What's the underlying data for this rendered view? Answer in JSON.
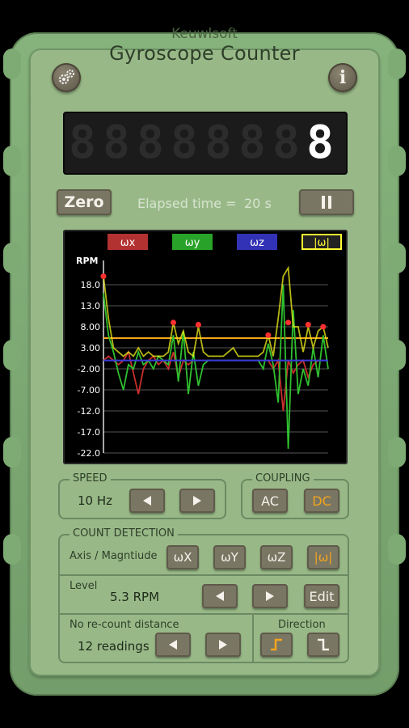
{
  "header": {
    "brand": "Keuwlsoft",
    "title": "Gyroscope Counter",
    "settings_icon": "gear-icon",
    "info_label": "i"
  },
  "counter": {
    "digits": [
      "8",
      "8",
      "8",
      "8",
      "8",
      "8",
      "8",
      "8"
    ],
    "active_index": 7
  },
  "controls": {
    "zero_label": "Zero",
    "elapsed_label": "Elapsed time =",
    "elapsed_value": "20 s",
    "pause_icon": "pause-icon"
  },
  "chart_data": {
    "type": "line",
    "legend": [
      "ωx",
      "ωy",
      "ωz",
      "|ω|"
    ],
    "legend_colors": [
      "#d23a3a",
      "#2fbf2f",
      "#3b3bd6",
      "#ffff33"
    ],
    "ylabel": "RPM",
    "yticks": [
      "18.0",
      "13.0",
      "8.00",
      "3.00",
      "-2.00",
      "-7.00",
      "-12.0",
      "-17.0",
      "-22.0"
    ],
    "ylim": [
      -22,
      23
    ],
    "level_line": 5.3,
    "series": [
      {
        "name": "ωx",
        "color": "#c8302c",
        "values": [
          0,
          1,
          0,
          -1,
          0,
          2,
          -3,
          -8,
          -2,
          0,
          1,
          -1,
          0,
          -2,
          2,
          -4,
          0,
          -1,
          0,
          0,
          0,
          0,
          0,
          0,
          0,
          0,
          0,
          0,
          0,
          0,
          0,
          0,
          0,
          0,
          -2,
          0,
          -12,
          0,
          -3,
          -1,
          0,
          -4,
          -1,
          0,
          0,
          0
        ]
      },
      {
        "name": "ωy",
        "color": "#2fbf2f",
        "values": [
          16,
          6,
          2,
          -3,
          -7,
          -1,
          -2,
          2,
          -1,
          0,
          -2,
          1,
          0,
          -1,
          6,
          -5,
          7,
          -8,
          2,
          -6,
          -1,
          0,
          0,
          0,
          0,
          0,
          0,
          0,
          0,
          0,
          0,
          0,
          -2,
          4,
          -1,
          -10,
          18,
          -21,
          12,
          -8,
          -2,
          -6,
          3,
          -4,
          6,
          -2
        ]
      },
      {
        "name": "ωz",
        "color": "#3a3ad8",
        "values": [
          0,
          0,
          0,
          0,
          0,
          0,
          0,
          0,
          0,
          0,
          0,
          0,
          0,
          0,
          0,
          0,
          0,
          0,
          0,
          0,
          0,
          0,
          0,
          0,
          0,
          0,
          0,
          0,
          0,
          0,
          0,
          0,
          0,
          0,
          0,
          0,
          0,
          0,
          0,
          0,
          0,
          0,
          0,
          0,
          0,
          0
        ]
      },
      {
        "name": "|ω|",
        "color": "#f2f21c",
        "values": [
          20,
          10,
          3,
          2,
          1,
          2,
          1,
          3,
          1,
          2,
          1,
          1,
          1,
          2,
          9,
          4,
          7,
          2,
          1,
          8,
          2,
          1,
          1,
          1,
          1,
          2,
          3,
          1,
          1,
          1,
          1,
          1,
          2,
          6,
          1,
          10,
          20,
          22,
          8,
          8,
          2,
          8,
          3,
          7,
          8,
          3
        ]
      }
    ],
    "peaks": [
      [
        0,
        20
      ],
      [
        14,
        9
      ],
      [
        19,
        8.5
      ],
      [
        33,
        6
      ],
      [
        37,
        9
      ],
      [
        41,
        8.5
      ],
      [
        44,
        8
      ]
    ]
  },
  "speed": {
    "title": "SPEED",
    "value": "10 Hz"
  },
  "coupling": {
    "title": "COUPLING",
    "ac_label": "AC",
    "dc_label": "DC"
  },
  "detection": {
    "title": "COUNT DETECTION",
    "axis_label": "Axis / Magntiude",
    "btn_x": "ωX",
    "btn_y": "ωY",
    "btn_z": "ωZ",
    "btn_mag": "|ω|",
    "level_label": "Level",
    "level_value": "5.3 RPM",
    "edit_label": "Edit",
    "recount_label": "No re-count distance",
    "recount_value": "12 readings",
    "direction_label": "Direction"
  },
  "colors": {
    "accent_orange": "#f3a51c",
    "body_green": "#86b37c"
  }
}
